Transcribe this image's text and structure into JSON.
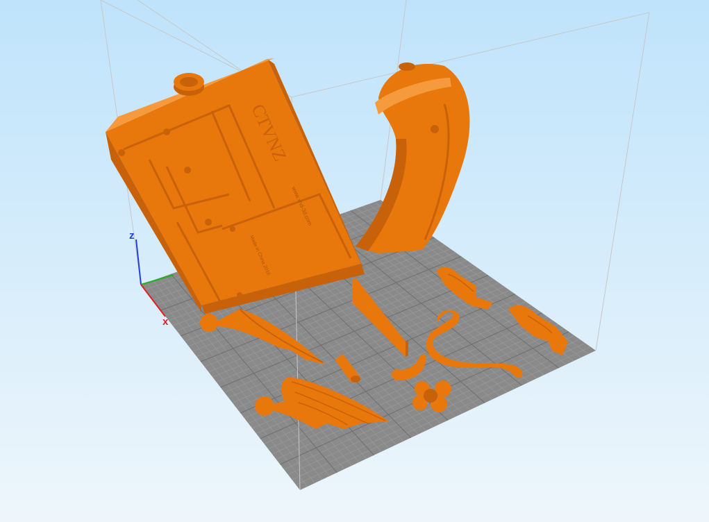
{
  "viewport": {
    "background_top": "#bfe3fb",
    "background_bottom": "#eef6fb"
  },
  "build_plate": {
    "color": "#8a8a8a",
    "grid_color": "#9b9b9b",
    "grid_major_color": "#6f6f6f"
  },
  "build_volume": {
    "line_color": "#c7c7c7"
  },
  "model": {
    "color": "#e8770c",
    "shade_color": "#c8620a",
    "highlight_color": "#f59a3d",
    "engraving_main": "CTVNZ",
    "engraving_small_1": "www.xhd-3d.com",
    "engraving_small_2": "Made in China 2016"
  },
  "axes": {
    "x_label": "x",
    "z_label": "z",
    "x_color": "#e02020",
    "y_color": "#20b020",
    "z_color": "#2040e0"
  }
}
